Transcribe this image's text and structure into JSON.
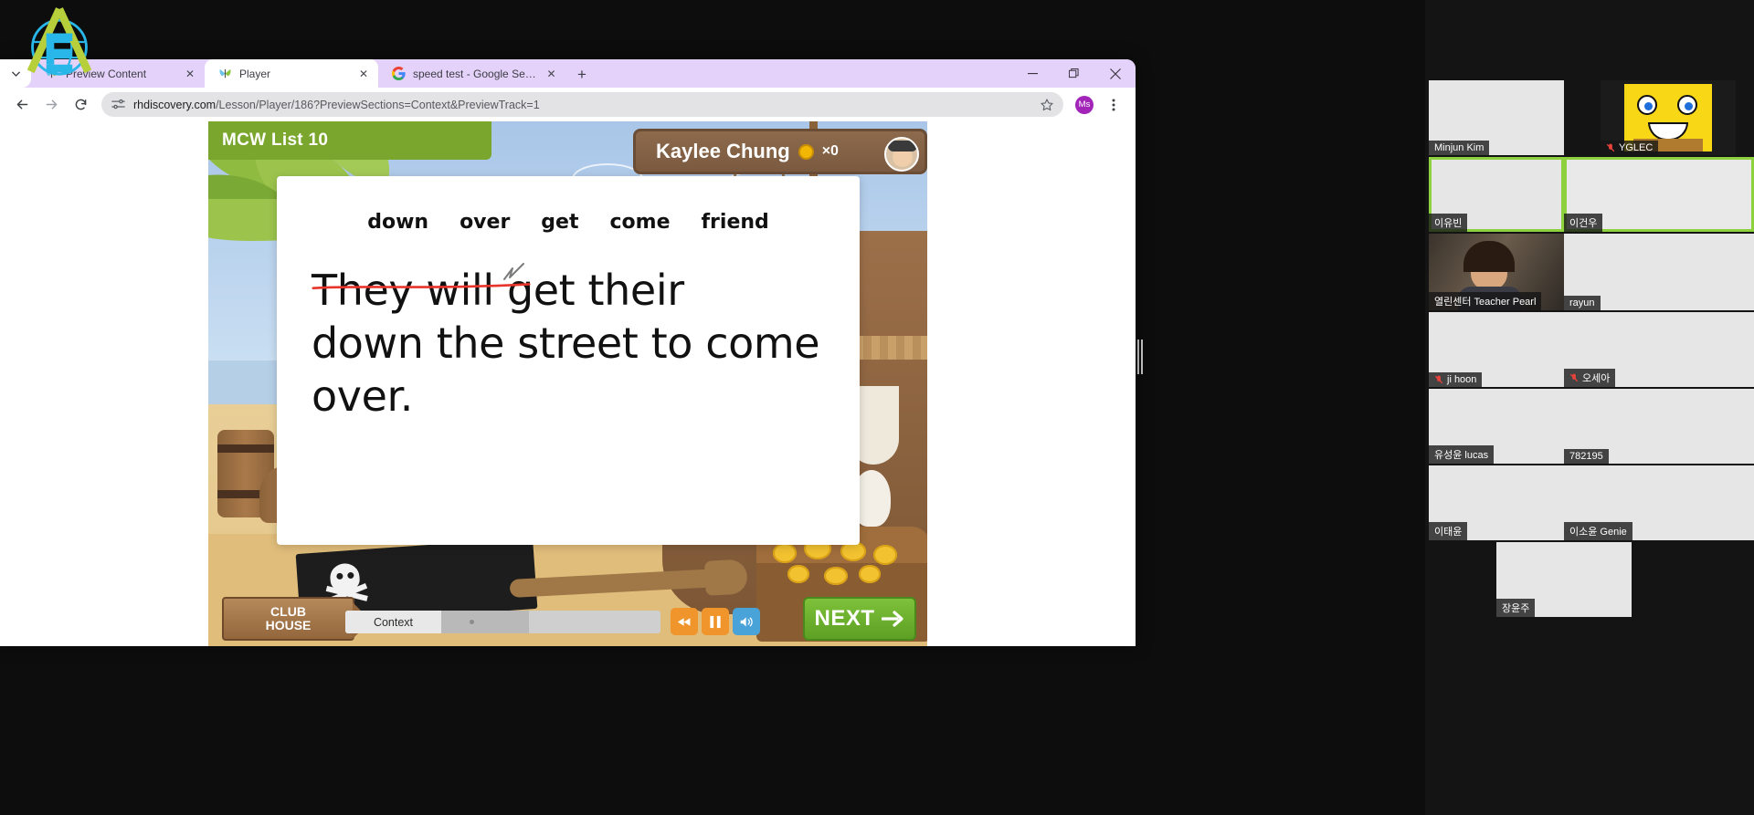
{
  "browser": {
    "tabs": [
      {
        "title": "Preview Content",
        "favicon": "butterfly-icon",
        "active": false
      },
      {
        "title": "Player",
        "favicon": "butterfly-icon",
        "active": true
      },
      {
        "title": "speed test - Google Search",
        "favicon": "google-icon",
        "active": false
      }
    ],
    "new_tab_label": "+",
    "tab_close_label": "✕",
    "tab_list_icon": "chevron-down-icon",
    "window_controls": {
      "minimize": "—",
      "maximize": "❐",
      "close": "✕"
    },
    "toolbar": {
      "back_icon": "back-arrow-icon",
      "forward_icon": "forward-arrow-icon",
      "reload_icon": "reload-icon",
      "site_info_icon": "tune-icon",
      "url_host": "rhdiscovery.com",
      "url_path": "/Lesson/Player/186?PreviewSections=Context&PreviewTrack=1",
      "url_full": "rhdiscovery.com/Lesson/Player/186?PreviewSections=Context&PreviewTrack=1",
      "bookmark_icon": "star-icon",
      "profile_initials": "Ms",
      "menu_icon": "three-dot-menu-icon"
    }
  },
  "lesson": {
    "title": "MCW List 10",
    "student_name": "Kaylee Chung",
    "coin_multiplier": "×0",
    "word_list": [
      "down",
      "over",
      "get",
      "come",
      "friend"
    ],
    "sentence": "They will get their down the street to come over.",
    "sentence_lines": [
      "They will get their",
      "down the street to come",
      "over."
    ],
    "annotation": "red-underline-and-check-mark",
    "controls": {
      "clubhouse_line1": "CLUB",
      "clubhouse_line2": "HOUSE",
      "section_label": "Context",
      "rewind_label": "rewind-icon",
      "pause_label": "pause-icon",
      "volume_label": "volume-icon",
      "next_label": "NEXT",
      "next_arrow": "➡"
    },
    "colors": {
      "banner_green": "#7aa62d",
      "next_green": "#5da024",
      "sign_brown": "#7a5a40",
      "annotation_red": "#e8342a"
    }
  },
  "conference": {
    "participants": [
      {
        "name": "Minjun Kim",
        "muted": false,
        "video": "off",
        "highlight": "none"
      },
      {
        "name": "YGLEC",
        "muted": true,
        "video": "spongebob",
        "highlight": "none"
      },
      {
        "name": "이유빈",
        "muted": false,
        "video": "off",
        "highlight": "green"
      },
      {
        "name": "이건우",
        "muted": false,
        "video": "off",
        "highlight": "green"
      },
      {
        "name": "열린센터 Teacher Pearl",
        "muted": false,
        "video": "on",
        "highlight": "none"
      },
      {
        "name": "rayun",
        "muted": false,
        "video": "off",
        "highlight": "none"
      },
      {
        "name": "ji hoon",
        "muted": true,
        "video": "off",
        "highlight": "none"
      },
      {
        "name": "오세아",
        "muted": true,
        "video": "off",
        "highlight": "none"
      },
      {
        "name": "유성윤 lucas",
        "muted": false,
        "video": "off",
        "highlight": "none"
      },
      {
        "name": "782195",
        "muted": false,
        "video": "off",
        "highlight": "none"
      },
      {
        "name": "이태윤",
        "muted": false,
        "video": "off",
        "highlight": "none"
      },
      {
        "name": "이소윤 Genie",
        "muted": false,
        "video": "off",
        "highlight": "none"
      },
      {
        "name": "장윤주",
        "muted": false,
        "video": "off",
        "highlight": "none"
      }
    ]
  }
}
